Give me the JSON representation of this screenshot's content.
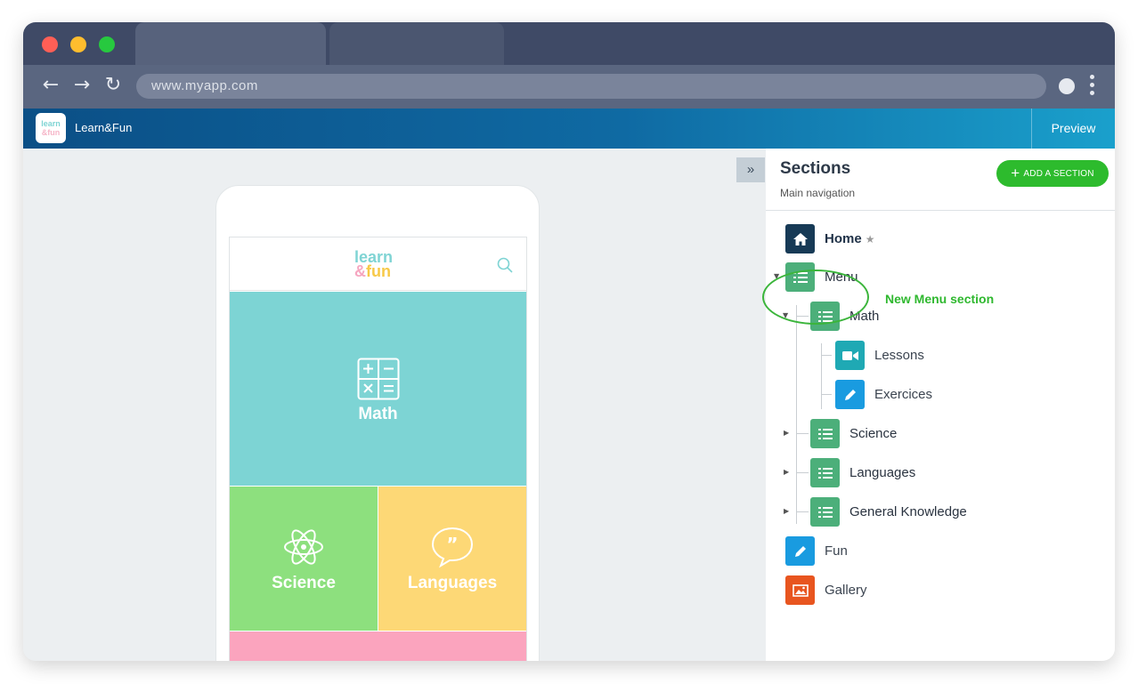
{
  "browser": {
    "url": "www.myapp.com",
    "nav_back": "←",
    "nav_forward": "→",
    "nav_reload": "↻"
  },
  "app": {
    "name": "Learn&Fun",
    "logo_text_1": "learn",
    "logo_text_2": "&fun",
    "preview_label": "Preview",
    "collapse_icon": "»"
  },
  "phone": {
    "logo_line1": "learn",
    "logo_amp": "&",
    "logo_line2": "fun",
    "tiles": {
      "math": "Math",
      "science": "Science",
      "languages": "Languages"
    }
  },
  "sidebar": {
    "title": "Sections",
    "subtitle": "Main navigation",
    "add_button": "ADD A SECTION",
    "add_icon": "+",
    "annotation": "New Menu section",
    "items": [
      {
        "label": "Home",
        "icon": "home-icon",
        "starred": true
      },
      {
        "label": "Menu",
        "icon": "list-icon"
      },
      {
        "label": "Math",
        "icon": "list-icon"
      },
      {
        "label": "Lessons",
        "icon": "video-icon"
      },
      {
        "label": "Exercices",
        "icon": "pencil-icon"
      },
      {
        "label": "Science",
        "icon": "list-icon"
      },
      {
        "label": "Languages",
        "icon": "list-icon"
      },
      {
        "label": "General Knowledge",
        "icon": "list-icon"
      },
      {
        "label": "Fun",
        "icon": "pencil-icon"
      },
      {
        "label": "Gallery",
        "icon": "image-icon"
      }
    ],
    "star_glyph": "★"
  },
  "colors": {
    "accent_green": "#2dbb2d",
    "app_header": "#0f6aa3",
    "tile_math": "#7dd4d4",
    "tile_science": "#8de07e",
    "tile_languages": "#fdd876",
    "tile_bottom": "#fba4be"
  }
}
